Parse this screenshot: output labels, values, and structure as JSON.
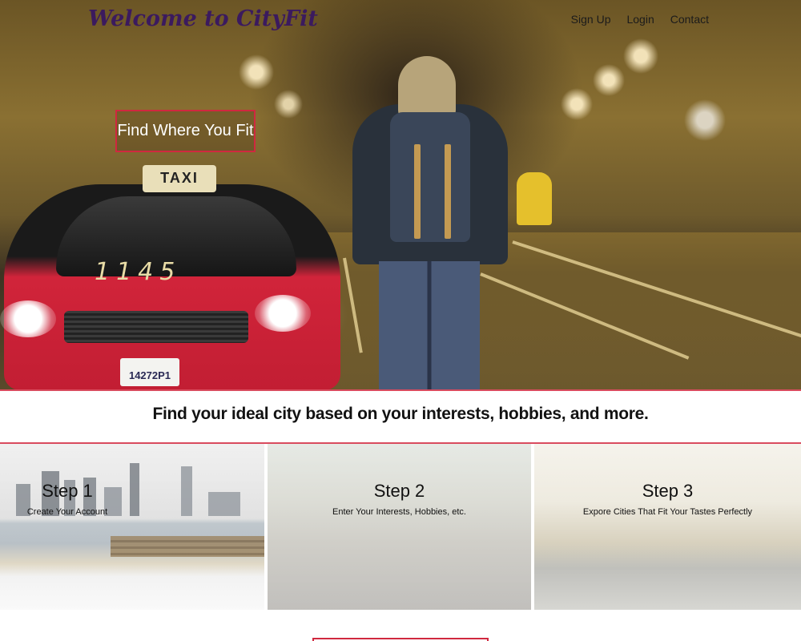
{
  "header": {
    "brand": "Welcome to CityFit",
    "nav": [
      {
        "label": "Sign Up"
      },
      {
        "label": "Login"
      },
      {
        "label": "Contact"
      }
    ]
  },
  "hero": {
    "cta_label": "Find Where You Fit",
    "taxi_sign": "TAXI",
    "taxi_number": "1145",
    "plate": "14272P1"
  },
  "tagline": "Find your ideal city based on your interests, hobbies, and more.",
  "steps": [
    {
      "title": "Step 1",
      "description": "Create Your Account"
    },
    {
      "title": "Step 2",
      "description": "Enter Your Interests, Hobbies, etc."
    },
    {
      "title": "Step 3",
      "description": "Expore Cities That Fit Your Tastes Perfectly"
    }
  ],
  "colors": {
    "accent": "#d0283f",
    "brand": "#3b1a5e"
  }
}
